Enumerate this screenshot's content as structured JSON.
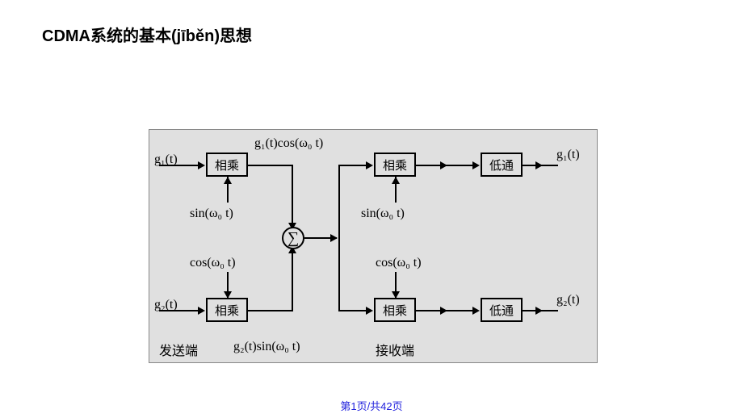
{
  "title": "CDMA系统的基本(jīběn)思想",
  "footer": "第1页/共42页",
  "labels": {
    "g1t_in": "g₁(t)",
    "g2t_in": "g₂(t)",
    "g1t_out": "g₁(t)",
    "g2t_out": "g₂(t)",
    "g1cos": "g₁(t)cos(ω₀ t)",
    "g2sin": "g₂(t)sin(ω₀ t)",
    "sinwt_l": "sin(ω₀ t)",
    "coswt_l": "cos(ω₀ t)",
    "sinwt_r": "sin(ω₀ t)",
    "coswt_r": "cos(ω₀ t)",
    "tx": "发送端",
    "rx": "接收端",
    "mult": "相乘",
    "lowpass": "低通",
    "sum": "∑"
  }
}
